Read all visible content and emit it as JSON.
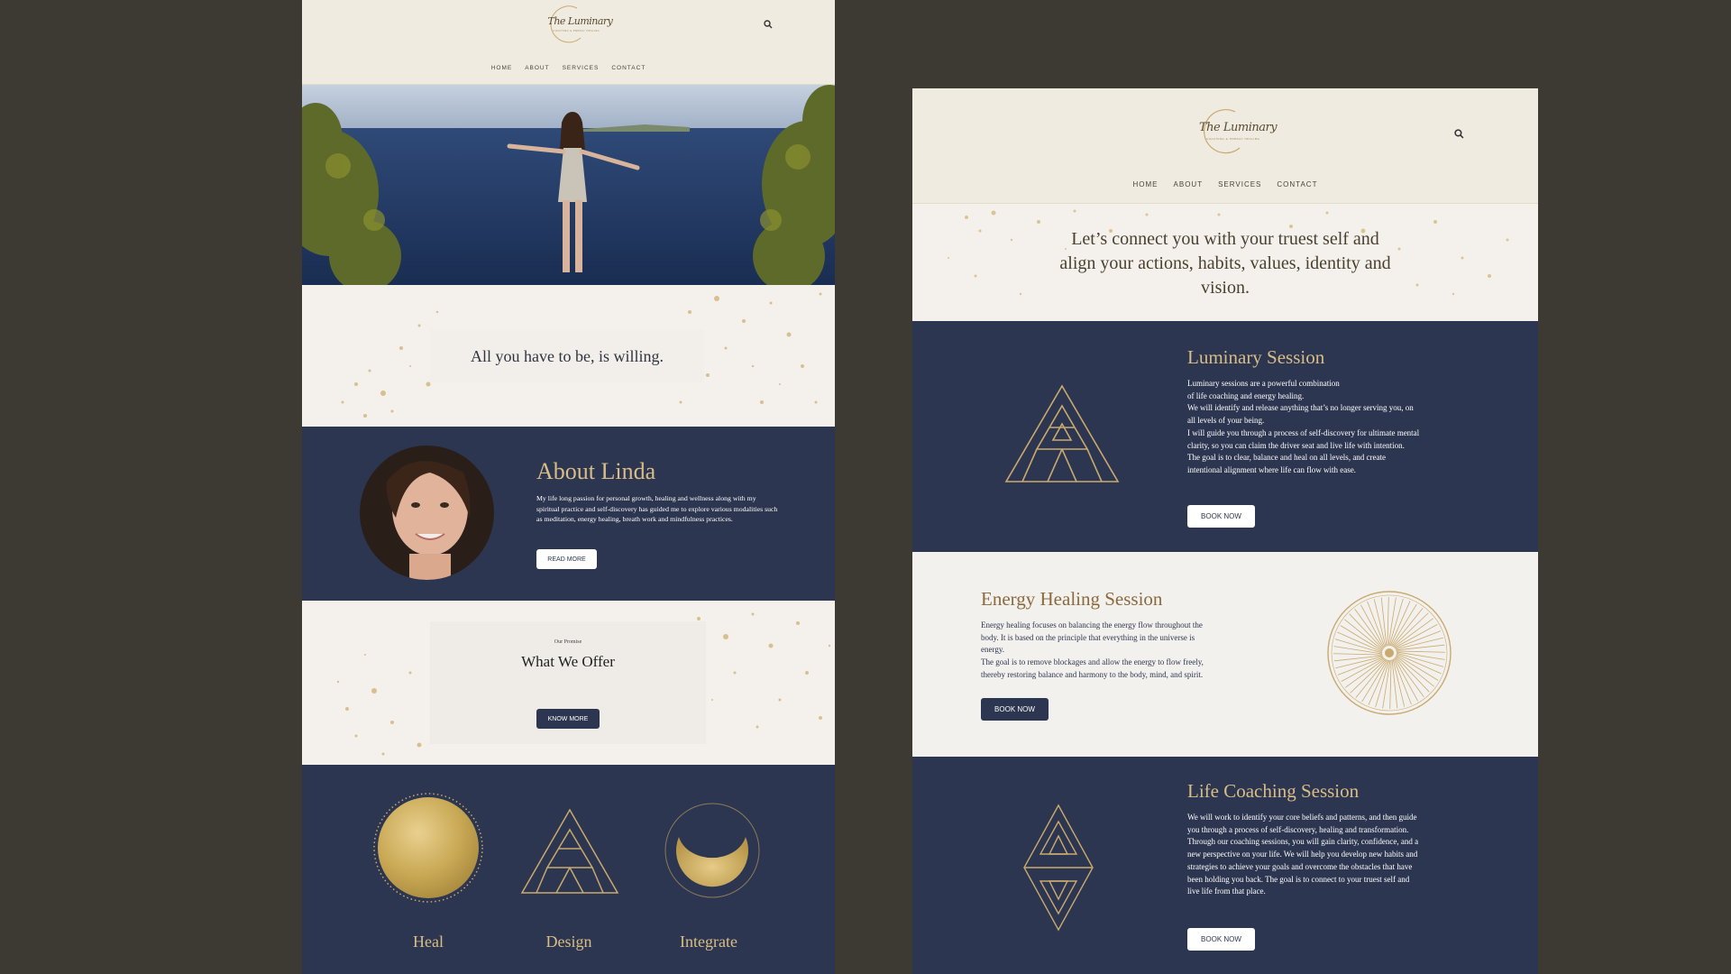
{
  "brand": {
    "logo_text": "The Luminary",
    "logo_sub": "COACHING & ENERGY HEALING"
  },
  "nav": {
    "home": "HOME",
    "about": "ABOUT",
    "services": "SERVICES",
    "contact": "CONTACT"
  },
  "left": {
    "quote": "All you have to be, is willing.",
    "about": {
      "title": "About Linda",
      "text": "My life long passion for personal growth, healing and wellness along with my spiritual practice and self-discovery has guided me to explore various modalities such as meditation, energy healing, breath work and mindfulness practices.",
      "button": "READ MORE"
    },
    "offer": {
      "eyebrow": "Our Promise",
      "title": "What We Offer",
      "button": "KNOW MORE"
    },
    "pillars": [
      {
        "label": "Heal"
      },
      {
        "label": "Design"
      },
      {
        "label": "Integrate"
      }
    ]
  },
  "right": {
    "intro": "Let’s connect you with your truest self and align your actions, habits, values, identity and vision.",
    "sessions": [
      {
        "title": "Luminary Session",
        "lines": [
          "Luminary sessions are a powerful combination",
          "of life coaching and energy healing.",
          "We will identify and release anything that’s no longer serving you, on",
          "all levels of your being.",
          "I will guide you through a process of self-discovery for ultimate mental",
          "clarity, so you can claim the driver seat and live life with intention.",
          "The goal is to clear, balance and heal on all levels, and create",
          "intentional alignment where life can flow with ease."
        ],
        "button": "BOOK NOW"
      },
      {
        "title": "Energy Healing Session",
        "lines": [
          "Energy healing focuses on balancing the energy flow throughout the",
          "body. It is based on the principle that everything in the universe is",
          "energy.",
          "The goal is to remove blockages and allow the energy to flow freely,",
          "thereby restoring balance and harmony to the body, mind, and spirit."
        ],
        "button": "BOOK NOW"
      },
      {
        "title": "Life Coaching Session",
        "lines": [
          "We will work to identify your core beliefs and patterns, and then guide",
          "you through a process of self-discovery, healing and transformation.",
          "Through our coaching sessions, you will gain clarity, confidence, and a",
          "new perspective on your life. We will help you develop new habits and",
          "strategies to achieve your goals and overcome the obstacles that have",
          "been holding you back. The goal is to connect to your truest self and",
          "live life from that place."
        ],
        "button": "BOOK NOW"
      }
    ]
  },
  "colors": {
    "navy": "#2d3650",
    "gold": "#d9bd86",
    "cream": "#f4f1ec",
    "background": "#3d3a33"
  }
}
